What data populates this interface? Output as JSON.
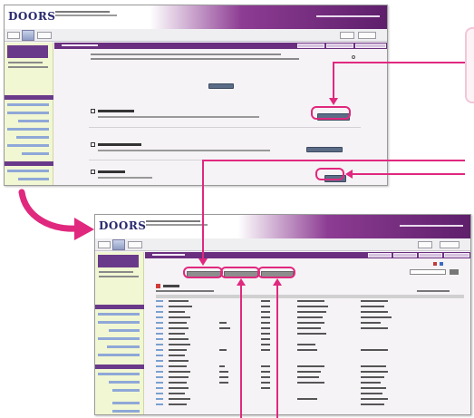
{
  "colors": {
    "accent_magenta": "#e0287e",
    "brand_purple": "#6a2f7f",
    "sidebar_green": "#f1f7d2",
    "action_button": "#5b6c86"
  },
  "icons": [
    "big-curved-arrow-icon",
    "arrowhead-icon"
  ],
  "screen1": {
    "app_logo": "DOORS"
  },
  "screen2": {
    "app_logo": "DOORS"
  }
}
